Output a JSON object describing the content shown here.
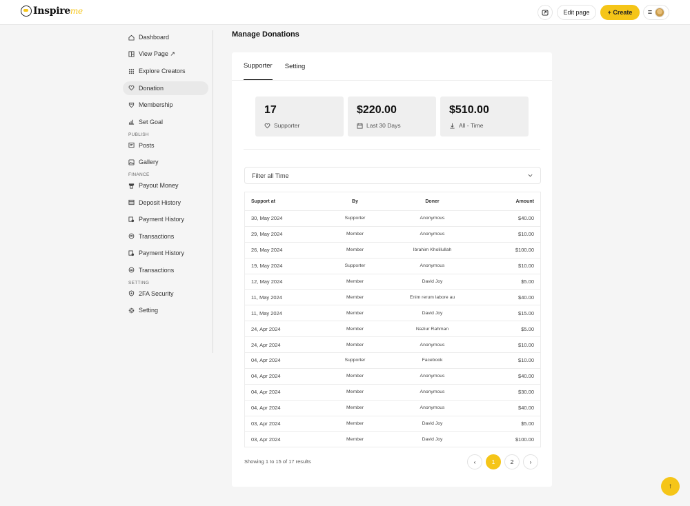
{
  "header": {
    "logo_text": "Inspire",
    "logo_accent": "me",
    "edit_label": "Edit page",
    "create_label": "+ Create",
    "menu_glyph": "≡"
  },
  "sidebar": {
    "items": [
      {
        "label": "Dashboard",
        "icon": "home-icon"
      },
      {
        "label": "View Page ↗",
        "icon": "layout-icon"
      },
      {
        "label": "Explore Creators",
        "icon": "grid-icon"
      },
      {
        "label": "Donation",
        "icon": "donation-icon",
        "active": true
      },
      {
        "label": "Membership",
        "icon": "membership-icon"
      },
      {
        "label": "Set Goal",
        "icon": "goal-icon"
      }
    ],
    "publish_title": "PUBLISH",
    "publish_items": [
      {
        "label": "Posts",
        "icon": "posts-icon"
      },
      {
        "label": "Gallery",
        "icon": "gallery-icon"
      }
    ],
    "finance_title": "FINANCE",
    "finance_items": [
      {
        "label": "Payout Money",
        "icon": "payout-icon"
      },
      {
        "label": "Deposit History",
        "icon": "deposit-icon"
      },
      {
        "label": "Payment History",
        "icon": "payment-icon"
      },
      {
        "label": "Transactions",
        "icon": "transactions-icon"
      },
      {
        "label": "Payment History",
        "icon": "payment-icon"
      },
      {
        "label": "Transactions",
        "icon": "transactions-icon"
      }
    ],
    "setting_title": "SETTING",
    "setting_items": [
      {
        "label": "2FA Security",
        "icon": "shield-icon"
      },
      {
        "label": "Setting",
        "icon": "gear-icon"
      }
    ]
  },
  "main": {
    "title": "Manage Donations",
    "tabs": [
      {
        "label": "Supporter",
        "active": true
      },
      {
        "label": "Setting"
      }
    ],
    "stats": [
      {
        "value": "17",
        "label": "Supporter",
        "icon": "heart-icon"
      },
      {
        "value": "$220.00",
        "label": "Last 30 Days",
        "icon": "calendar-icon"
      },
      {
        "value": "$510.00",
        "label": "All - Time",
        "icon": "total-icon"
      }
    ],
    "filter": {
      "selected": "Filter all Time"
    },
    "table": {
      "columns": [
        "Support at",
        "By",
        "Doner",
        "Amount"
      ],
      "rows": [
        [
          "30, May 2024",
          "Supporter",
          "Anonymous",
          "$40.00"
        ],
        [
          "29, May 2024",
          "Member",
          "Anonymous",
          "$10.00"
        ],
        [
          "26, May 2024",
          "Member",
          "Ibrahim Kholilullah",
          "$100.00"
        ],
        [
          "19, May 2024",
          "Supporter",
          "Anonymous",
          "$10.00"
        ],
        [
          "12, May 2024",
          "Member",
          "David Joy",
          "$5.00"
        ],
        [
          "11, May 2024",
          "Member",
          "Enim rerum labore au",
          "$40.00"
        ],
        [
          "11, May 2024",
          "Member",
          "David Joy",
          "$15.00"
        ],
        [
          "24, Apr 2024",
          "Member",
          "Naziur Rahman",
          "$5.00"
        ],
        [
          "24, Apr 2024",
          "Member",
          "Anonymous",
          "$10.00"
        ],
        [
          "04, Apr 2024",
          "Supporter",
          "Facebook",
          "$10.00"
        ],
        [
          "04, Apr 2024",
          "Member",
          "Anonymous",
          "$40.00"
        ],
        [
          "04, Apr 2024",
          "Member",
          "Anonymous",
          "$30.00"
        ],
        [
          "04, Apr 2024",
          "Member",
          "Anonymous",
          "$40.00"
        ],
        [
          "03, Apr 2024",
          "Member",
          "David Joy",
          "$5.00"
        ],
        [
          "03, Apr 2024",
          "Member",
          "David Joy",
          "$100.00"
        ]
      ]
    },
    "pagination": {
      "summary": "Showing 1 to 15 of 17 results",
      "prev": "‹",
      "pages": [
        "1",
        "2"
      ],
      "current": "1",
      "next": "›"
    }
  },
  "scroll_top": "↑",
  "colors": {
    "accent": "#f5c518",
    "background": "#f5f5f5",
    "stat_bg": "#efefef"
  }
}
